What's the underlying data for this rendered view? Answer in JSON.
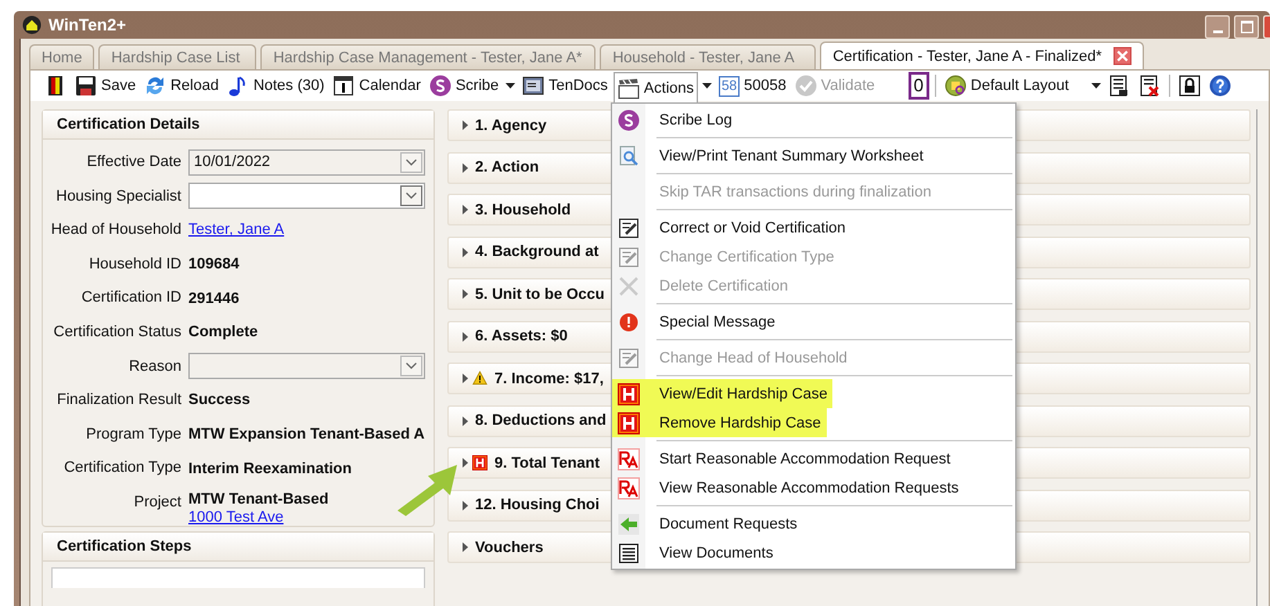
{
  "window": {
    "title": "WinTen2+"
  },
  "tabs": [
    {
      "label": "Home",
      "selected": false,
      "closable": false
    },
    {
      "label": "Hardship Case List",
      "selected": false,
      "closable": false
    },
    {
      "label": "Hardship Case Management - Tester, Jane A*",
      "selected": false,
      "closable": false
    },
    {
      "label": "Household - Tester, Jane A",
      "selected": false,
      "closable": false
    },
    {
      "label": "Certification - Tester, Jane A - Finalized*",
      "selected": true,
      "closable": true
    }
  ],
  "toolbar": [
    {
      "kind": "button"
    },
    {
      "kind": "button",
      "label": "Save"
    },
    {
      "kind": "button",
      "label": "Reload"
    },
    {
      "kind": "button",
      "label": "Notes (30)"
    },
    {
      "kind": "button",
      "label": "Calendar"
    },
    {
      "kind": "button",
      "label": "Scribe"
    },
    {
      "kind": "caret"
    },
    {
      "kind": "button",
      "label": "TenDocs"
    },
    {
      "kind": "button",
      "label": "Actions",
      "open": true
    },
    {
      "kind": "caret"
    },
    {
      "kind": "code",
      "code": "58",
      "label": "50058"
    },
    {
      "kind": "button",
      "label": "Validate",
      "disabled": true
    },
    {
      "kind": "counter",
      "label": "0"
    },
    {
      "kind": "separator"
    },
    {
      "kind": "button",
      "label": "Default Layout"
    },
    {
      "kind": "caret"
    },
    {
      "kind": "button"
    },
    {
      "kind": "button"
    },
    {
      "kind": "separator"
    },
    {
      "kind": "button"
    },
    {
      "kind": "button"
    }
  ],
  "details": {
    "title": "Certification Details",
    "fields": [
      {
        "label": "Effective Date",
        "kind": "combo",
        "value": "10/01/2022",
        "disabled": true
      },
      {
        "label": "Housing Specialist",
        "kind": "combo",
        "disabled": false
      },
      {
        "label": "Head of Household",
        "kind": "link",
        "value": "Tester, Jane A"
      },
      {
        "label": "Household ID",
        "kind": "text",
        "value": "109684"
      },
      {
        "label": "Certification ID",
        "kind": "text",
        "value": "291446"
      },
      {
        "label": "Certification Status",
        "kind": "text",
        "value": "Complete"
      },
      {
        "label": "Reason",
        "kind": "combo",
        "disabled": true
      },
      {
        "label": "Finalization Result",
        "kind": "text",
        "value": "Success"
      },
      {
        "label": "Program Type",
        "kind": "text",
        "value": "MTW Expansion Tenant-Based A"
      },
      {
        "label": "Certification Type",
        "kind": "text",
        "value": "Interim Reexamination"
      },
      {
        "label": "Project",
        "kind": "text",
        "value": "MTW Tenant-Based",
        "link": "1000 Test Ave"
      }
    ]
  },
  "steps": {
    "title": "Certification Steps"
  },
  "sections": [
    {
      "label": "1. Agency",
      "kind": "plain"
    },
    {
      "label": "2. Action",
      "kind": "plain"
    },
    {
      "label": "3. Household",
      "kind": "plain"
    },
    {
      "label": "4. Background at",
      "kind": "plain"
    },
    {
      "label": "5. Unit to be Occu",
      "kind": "plain"
    },
    {
      "label": "6. Assets: $0",
      "kind": "plain"
    },
    {
      "label": "7. Income: $17,",
      "kind": "warning"
    },
    {
      "label": "8. Deductions and",
      "kind": "plain"
    },
    {
      "label": "9. Total Tenant",
      "kind": "hardship"
    },
    {
      "label": "12. Housing Choi",
      "kind": "plain"
    },
    {
      "label": "Vouchers",
      "kind": "plain"
    }
  ],
  "actions_menu": [
    [
      {
        "label": "Scribe Log",
        "disabled": false,
        "highlighted": false
      }
    ],
    [
      {
        "label": "View/Print Tenant Summary Worksheet",
        "disabled": false,
        "highlighted": false
      }
    ],
    [
      {
        "label": "Skip TAR transactions during finalization",
        "disabled": true,
        "highlighted": false
      }
    ],
    [
      {
        "label": "Correct or Void Certification",
        "disabled": false,
        "highlighted": false
      },
      {
        "label": "Change Certification Type",
        "disabled": true,
        "highlighted": false
      },
      {
        "label": "Delete Certification",
        "disabled": true,
        "highlighted": false
      }
    ],
    [
      {
        "label": "Special Message",
        "disabled": false,
        "highlighted": false
      }
    ],
    [
      {
        "label": "Change Head of Household",
        "disabled": true,
        "highlighted": false
      }
    ],
    [
      {
        "label": "View/Edit Hardship Case",
        "disabled": false,
        "highlighted": true
      },
      {
        "label": "Remove Hardship Case",
        "disabled": false,
        "highlighted": true
      }
    ],
    [
      {
        "label": "Start Reasonable Accommodation Request",
        "disabled": false,
        "highlighted": false
      },
      {
        "label": "View Reasonable Accommodation Requests",
        "disabled": false,
        "highlighted": false
      }
    ],
    [
      {
        "label": "Document Requests",
        "disabled": false,
        "highlighted": false
      },
      {
        "label": "View Documents",
        "disabled": false,
        "highlighted": false
      }
    ]
  ]
}
